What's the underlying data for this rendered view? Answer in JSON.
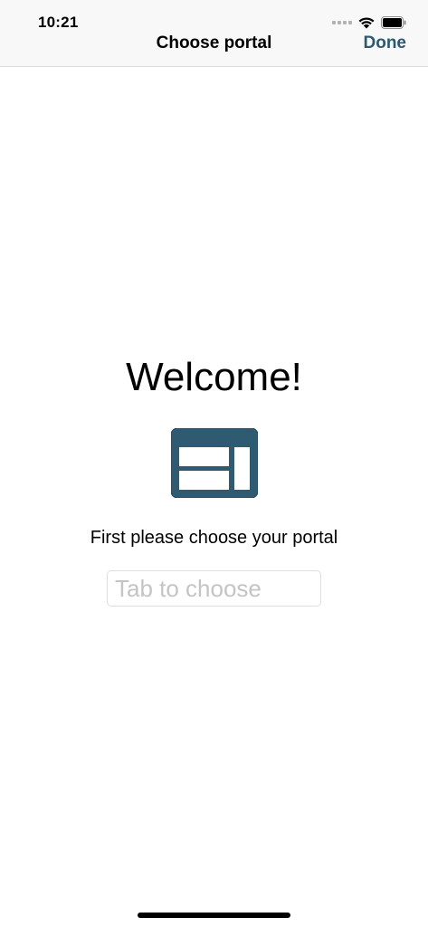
{
  "status_bar": {
    "time": "10:21",
    "icons": [
      "signal-icon",
      "wifi-icon",
      "battery-icon"
    ]
  },
  "nav": {
    "title": "Choose portal",
    "done_label": "Done"
  },
  "main": {
    "heading": "Welcome!",
    "icon": "portal-layout-icon",
    "instruction": "First please choose your portal",
    "input_placeholder": "Tab to choose",
    "input_value": ""
  },
  "colors": {
    "accent": "#2a5a70",
    "icon_fill": "#2e5b72",
    "bar_background": "#f8f8f8"
  }
}
